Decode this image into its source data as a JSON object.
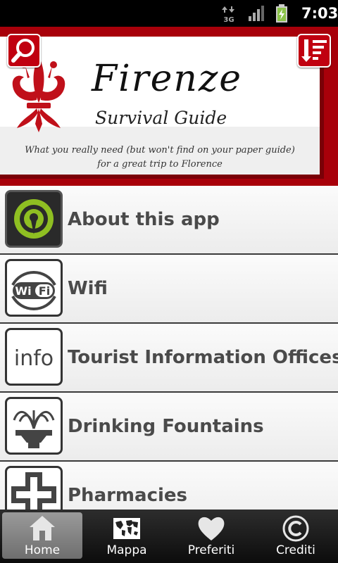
{
  "status_bar": {
    "network_type": "3G",
    "time": "7:03",
    "icons": [
      "data-arrows-3g-icon",
      "signal-strength-icon",
      "battery-charging-icon"
    ]
  },
  "banner": {
    "title": "Firenze",
    "subtitle": "Survival Guide",
    "tagline_line1": "What you really need (but won't find on your paper guide)",
    "tagline_line2": "for a great trip to Florence",
    "logo": "florence-lily-icon",
    "search_icon": "search-icon",
    "menu_icon": "list-sort-icon",
    "colors": {
      "brand_red": "#c00010",
      "banner_red": "#a8000a"
    }
  },
  "list": {
    "items": [
      {
        "label": "About this app",
        "icon": "map-pin-app-icon"
      },
      {
        "label": "Wifi",
        "icon": "wifi-icon",
        "icon_text": "Wi Fi"
      },
      {
        "label": "Tourist Information Offices",
        "icon": "info-icon",
        "icon_text": "info"
      },
      {
        "label": "Drinking Fountains",
        "icon": "fountain-icon"
      },
      {
        "label": "Pharmacies",
        "icon": "pharmacy-cross-icon"
      }
    ]
  },
  "tabs": [
    {
      "label": "Home",
      "icon": "home-icon",
      "active": true
    },
    {
      "label": "Mappa",
      "icon": "world-map-icon",
      "active": false
    },
    {
      "label": "Preferiti",
      "icon": "heart-icon",
      "active": false
    },
    {
      "label": "Crediti",
      "icon": "copyright-icon",
      "active": false
    }
  ]
}
